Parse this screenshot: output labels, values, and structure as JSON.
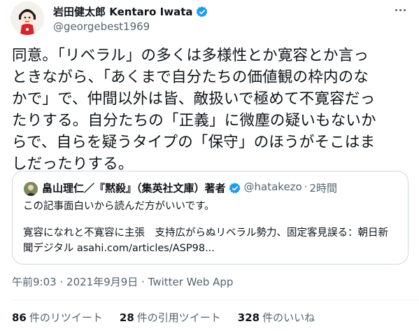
{
  "author": {
    "name": "岩田健太郎 Kentaro Iwata",
    "handle": "@georgebest1969",
    "verified": true
  },
  "tweet": {
    "lines": [
      "同意。「リベラル」の多くは多様性とか寛容とか言っ",
      "ときながら、「あくまで自分たちの価値観の枠内のな",
      "かで」で、仲間以外は皆、敵扱いで極めて不寛容だっ",
      "たりする。自分たちの「正義」に微塵の疑いもないか",
      "らで、自らを疑うタイプの「保守」のほうがそこはま",
      "しだったりする。"
    ]
  },
  "quote": {
    "name": "畠山理仁／『黙殺』（集英社文庫）著者",
    "verified": true,
    "handle": "@hatakezo",
    "separator": "·",
    "time": "2時間",
    "body_line1": "この記事面白いから読んだ方がいいです。",
    "body_line2": "寛容になれと不寛容に主張　支持広がらぬリベラル勢力、固定客見誤る：朝日新",
    "body_line3": "聞デジタル asahi.com/articles/ASP98..."
  },
  "meta": {
    "time": "午前9:03",
    "date": "2021年9月9日",
    "separator": "·",
    "app": "Twitter Web App"
  },
  "stats": [
    {
      "count": "86",
      "label": "件のリツイート"
    },
    {
      "count": "28",
      "label": "件の引用ツイート"
    },
    {
      "count": "328",
      "label": "件のいいね"
    }
  ],
  "colors": {
    "verified": "#1d9bf0",
    "secondary_text": "#536471",
    "border": "#cfd9de"
  },
  "icons": {
    "verified": "verified-badge-icon",
    "more": "more-horizontal-icon"
  }
}
